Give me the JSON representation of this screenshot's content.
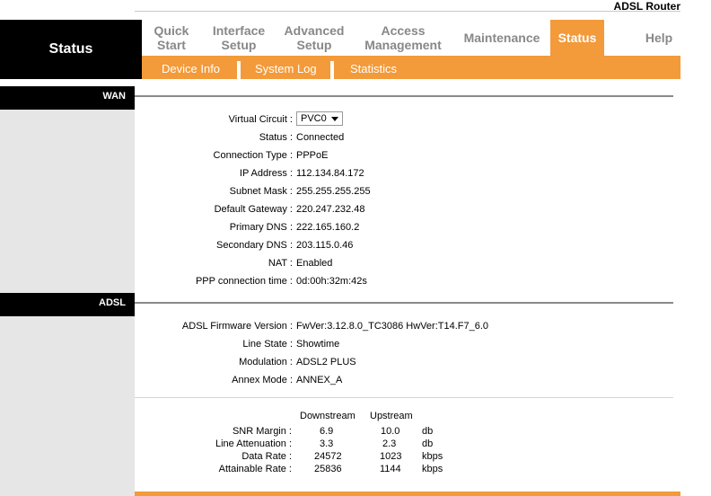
{
  "header": {
    "product": "ADSL Router",
    "page_title": "Status"
  },
  "nav": {
    "quick_start": "Quick\nStart",
    "interface_setup": "Interface\nSetup",
    "advanced_setup": "Advanced\nSetup",
    "access_management": "Access\nManagement",
    "maintenance": "Maintenance",
    "status": "Status",
    "help": "Help"
  },
  "subnav": {
    "device_info": "Device Info",
    "system_log": "System Log",
    "statistics": "Statistics"
  },
  "wan": {
    "section": "WAN",
    "virtual_circuit": {
      "label": "Virtual Circuit :",
      "value": "PVC0"
    },
    "status": {
      "label": "Status :",
      "value": "Connected"
    },
    "connection_type": {
      "label": "Connection Type :",
      "value": "PPPoE"
    },
    "ip_address": {
      "label": "IP Address :",
      "value": "112.134.84.172"
    },
    "subnet_mask": {
      "label": "Subnet Mask :",
      "value": "255.255.255.255"
    },
    "default_gateway": {
      "label": "Default Gateway :",
      "value": "220.247.232.48"
    },
    "primary_dns": {
      "label": "Primary DNS :",
      "value": "222.165.160.2"
    },
    "secondary_dns": {
      "label": "Secondary DNS :",
      "value": "203.115.0.46"
    },
    "nat": {
      "label": "NAT :",
      "value": "Enabled"
    },
    "ppp_time": {
      "label": "PPP connection time :",
      "value": "0d:00h:32m:42s"
    }
  },
  "adsl": {
    "section": "ADSL",
    "firmware": {
      "label": "ADSL Firmware Version :",
      "value": "FwVer:3.12.8.0_TC3086 HwVer:T14.F7_6.0"
    },
    "line_state": {
      "label": "Line State :",
      "value": "Showtime"
    },
    "modulation": {
      "label": "Modulation :",
      "value": "ADSL2 PLUS"
    },
    "annex_mode": {
      "label": "Annex Mode :",
      "value": "ANNEX_A"
    },
    "stats": {
      "headers": {
        "downstream": "Downstream",
        "upstream": "Upstream"
      },
      "rows": [
        {
          "label": "SNR Margin :",
          "down": "6.9",
          "up": "10.0",
          "unit": "db"
        },
        {
          "label": "Line Attenuation :",
          "down": "3.3",
          "up": "2.3",
          "unit": "db"
        },
        {
          "label": "Data Rate :",
          "down": "24572",
          "up": "1023",
          "unit": "kbps"
        },
        {
          "label": "Attainable Rate :",
          "down": "25836",
          "up": "1144",
          "unit": "kbps"
        }
      ]
    }
  },
  "colors": {
    "accent": "#f39a3a",
    "title_bg": "#000000",
    "sidebar_bg": "#e6e6e6",
    "nav_text": "#888888"
  }
}
